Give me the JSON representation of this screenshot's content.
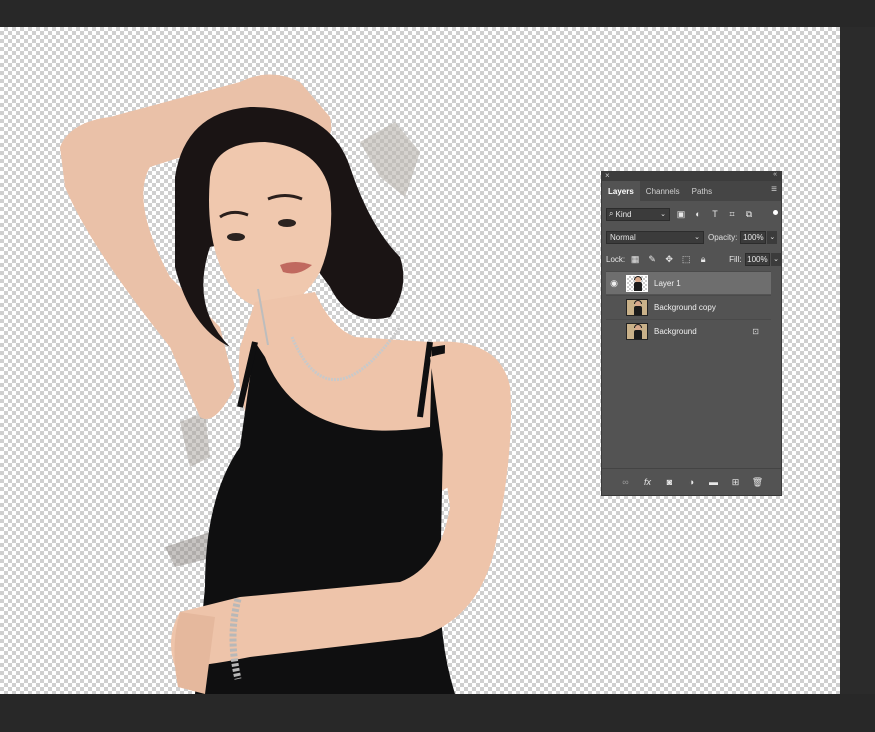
{
  "layers_panel": {
    "tabs": [
      "Layers",
      "Channels",
      "Paths"
    ],
    "active_tab": "Layers",
    "filter": {
      "kind_label": "Kind"
    },
    "blend_mode": "Normal",
    "opacity_label": "Opacity:",
    "opacity_value": "100%",
    "lock_label": "Lock:",
    "fill_label": "Fill:",
    "fill_value": "100%",
    "layers": [
      {
        "name": "Layer 1",
        "visible": true,
        "selected": true,
        "locked": false
      },
      {
        "name": "Background copy",
        "visible": false,
        "selected": false,
        "locked": false
      },
      {
        "name": "Background",
        "visible": false,
        "selected": false,
        "locked": true
      }
    ],
    "footer_icons": [
      "link-icon",
      "fx-icon",
      "mask-icon",
      "adjustment-icon",
      "folder-icon",
      "new-layer-icon",
      "trash-icon"
    ],
    "footer_fx_label": "fx"
  },
  "colors": {
    "app_background": "#282828",
    "panel_background": "#535353",
    "selected_layer": "#6e6e6e"
  }
}
